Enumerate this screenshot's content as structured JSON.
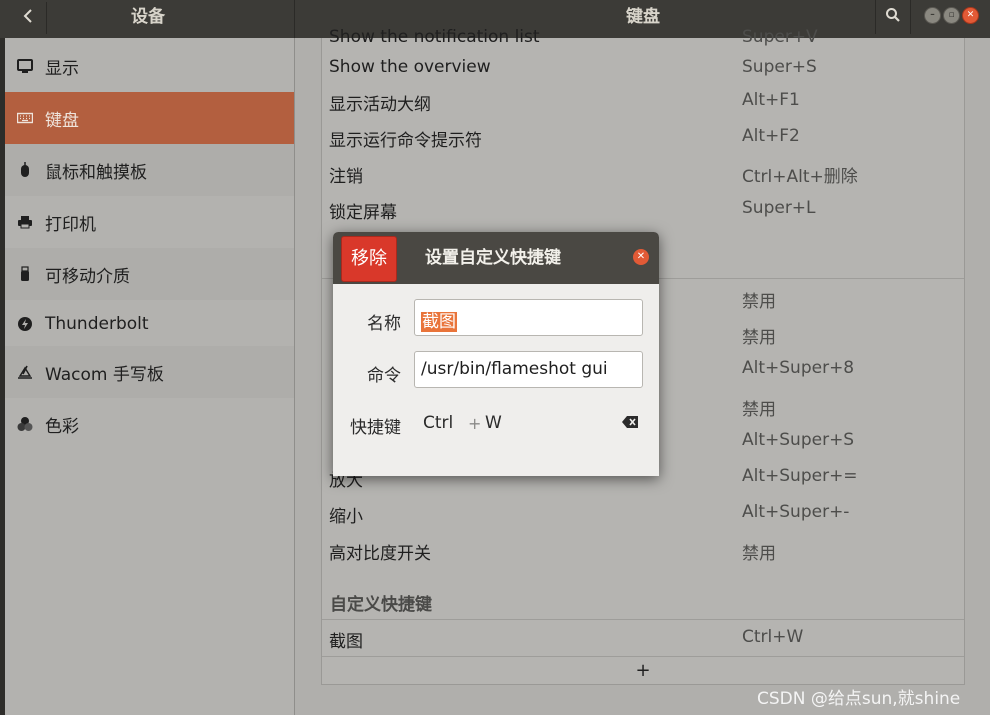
{
  "titlebar": {
    "left_title": "设备",
    "center_title": "键盘",
    "back_icon": "chevron-left-icon",
    "search_icon": "search-icon"
  },
  "sidebar": {
    "items": [
      {
        "label": "显示",
        "icon": "display-icon"
      },
      {
        "label": "键盘",
        "icon": "keyboard-icon",
        "active": true
      },
      {
        "label": "鼠标和触摸板",
        "icon": "mouse-icon"
      },
      {
        "label": "打印机",
        "icon": "printer-icon"
      },
      {
        "label": "可移动介质",
        "icon": "usb-drive-icon"
      },
      {
        "label": "Thunderbolt",
        "icon": "thunderbolt-icon"
      },
      {
        "label": "Wacom 手写板",
        "icon": "tablet-icon"
      },
      {
        "label": "色彩",
        "icon": "color-icon"
      }
    ]
  },
  "shortcuts": {
    "top_cut_row": {
      "name": "Show the notification list",
      "accel": "Super+V"
    },
    "rows": [
      {
        "name": "Show the overview",
        "accel": "Super+S"
      },
      {
        "name": "显示活动大纲",
        "accel": "Alt+F1"
      },
      {
        "name": "显示运行命令提示符",
        "accel": "Alt+F2"
      },
      {
        "name": "注销",
        "accel": "Ctrl+Alt+删除"
      },
      {
        "name": "锁定屏幕",
        "accel": "Super+L"
      }
    ],
    "accessibility_rows": [
      {
        "name": "",
        "accel": "禁用"
      },
      {
        "name": "",
        "accel": "禁用"
      },
      {
        "name": "",
        "accel": "Alt+Super+8"
      },
      {
        "name": "",
        "accel": "禁用"
      },
      {
        "name": "",
        "accel": "Alt+Super+S"
      },
      {
        "name": "放大",
        "accel": "Alt+Super+="
      },
      {
        "name": "缩小",
        "accel": "Alt+Super+-"
      },
      {
        "name": "高对比度开关",
        "accel": "禁用"
      }
    ],
    "custom_section_title": "自定义快捷键",
    "custom_rows": [
      {
        "name": "截图",
        "accel": "Ctrl+W"
      }
    ],
    "add_label": "+"
  },
  "dialog": {
    "remove_label": "移除",
    "title": "设置自定义快捷键",
    "close_icon": "close-icon",
    "name_label": "名称",
    "name_value": "截图",
    "command_label": "命令",
    "command_value": "/usr/bin/flameshot gui",
    "shortcut_label": "快捷键",
    "shortcut_key1": "Ctrl",
    "shortcut_plus": "+",
    "shortcut_key2": "W",
    "backspace_icon": "backspace-icon"
  },
  "watermark": "CSDN @给点sun,就shine"
}
